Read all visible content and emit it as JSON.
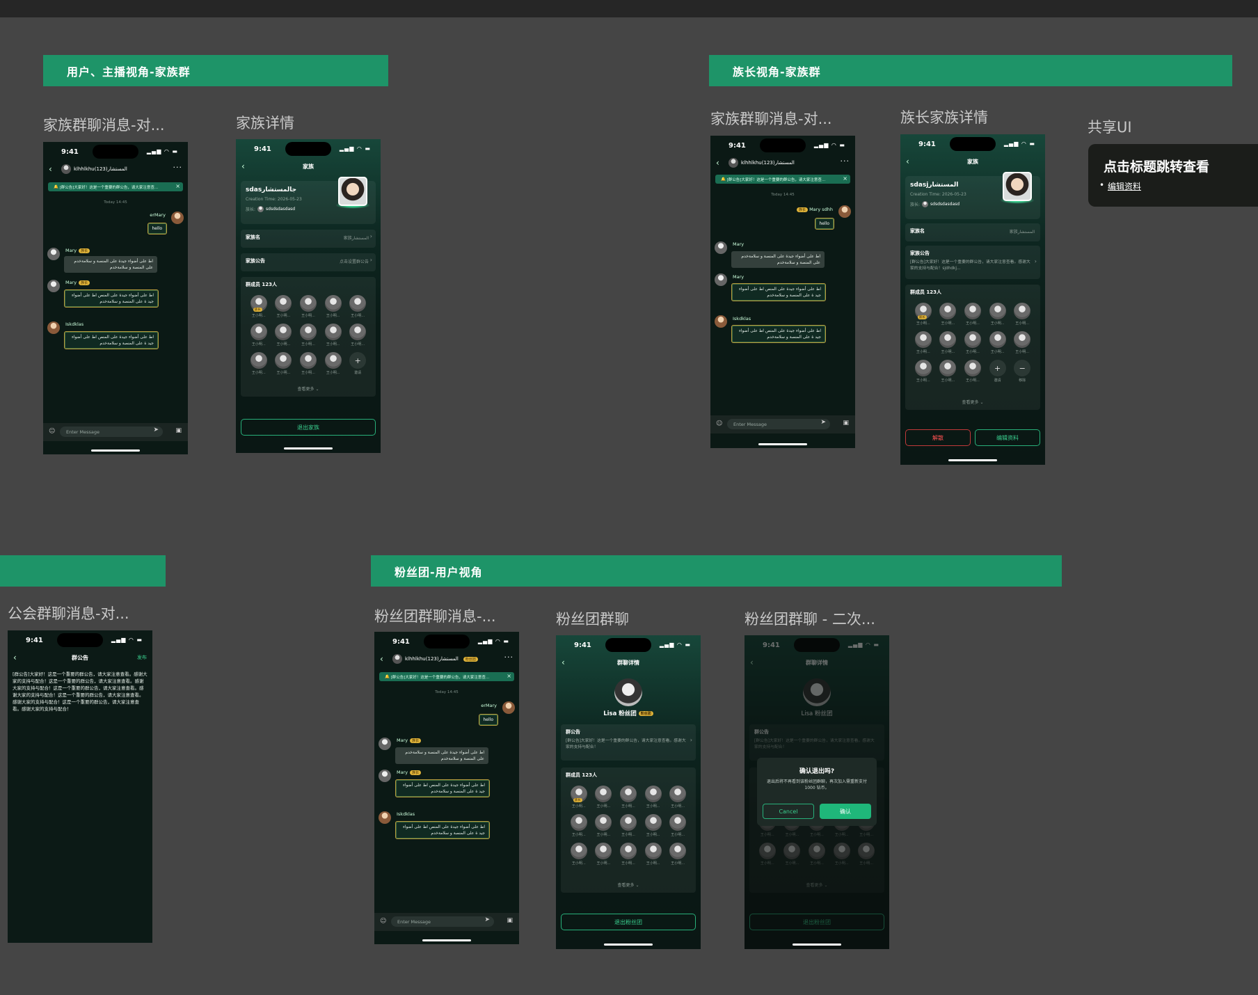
{
  "sections": {
    "user_family": "用户、主播视角-家族群",
    "leader_family": "族长视角-家族群",
    "guild": "",
    "fans": "粉丝团-用户视角"
  },
  "frame_titles": {
    "f1": "家族群聊消息-对...",
    "f2": "家族详情",
    "f3": "家族群聊消息-对...",
    "f4": "族长家族详情",
    "f5": "共享UI",
    "f6": "公会群聊消息-对...",
    "f7": "粉丝团群聊消息-...",
    "f8": "粉丝团群聊",
    "f9": "粉丝团群聊 - 二次..."
  },
  "shared_card": {
    "title": "点击标题跳转查看",
    "link": "编辑资料"
  },
  "status": {
    "time": "9:41",
    "icons": "▂▄▆ ◠ ▬"
  },
  "chat": {
    "group_name": "klhhlkhuالمستشار(123)",
    "fans_badge": "粉丝团",
    "notice": "[群公告]大家好！这是一个重要的群公告，请大家注意查...",
    "timestamp": "Today 14:45",
    "sender_self": "erMary",
    "sender_self_leader": "Mary sdhh",
    "leader_badge": "族长",
    "hello": "hello",
    "mary": "Mary",
    "mary_badge": "族长",
    "iskdklas": "Iskdklas",
    "arabic_gray": "اط على أضواء جيدة على المنصة و سلامةخدم على المنصة و سلامةخدم",
    "arabic_gold": "اط على أضواء جيدة على المنص اط على أضواء جيد ة على المنصة و سلامةخدم",
    "input_placeholder": "Enter Message"
  },
  "family": {
    "nav_title": "家族",
    "name": "sdasجالمستشار",
    "leader_name": "sdasjالمستشار",
    "creation": "Creation Time: 2026-05-23",
    "owner_label": "族长:",
    "owner_name": "sdsdsdasdasd",
    "row_name_label": "家族名",
    "row_name_value": "家族المستشار",
    "row_notice_label": "家族公告",
    "row_notice_value": "点击设置群公告",
    "leader_notice_text": "[群公告]大家好！这是一个重要的群公告，请大家注意查看。感谢大家的支持与配合！sjdhdkj...",
    "members_label": "群成员 123人",
    "member": "王小明...",
    "owner_tag": "族长",
    "invite": "邀请",
    "remove": "移除",
    "see_more": "查看更多 ⌄",
    "quit_btn": "退出家族",
    "disband_btn": "解散",
    "edit_btn": "编辑资料"
  },
  "guild": {
    "nav_title": "群公告",
    "publish": "发布",
    "text": "[群公告]大家好！这是一个重要的群公告，请大家注意查看。感谢大家的支持与配合！这是一个重要的群公告，请大家注意查看。感谢大家的支持与配合！这是一个重要的群公告，请大家注意查看。感谢大家的支持与配合！这是一个重要的群公告，请大家注意查看。感谢大家的支持与配合！这是一个重要的群公告，请大家注意查看。感谢大家的支持与配合！"
  },
  "fans": {
    "nav_title": "群聊详情",
    "name": "Lisa 粉丝团",
    "badge": "粉丝团",
    "notice_label": "群公告",
    "notice_text": "[群公告]大家好！这是一个重要的群公告，请大家注意查看。感谢大家的支持与配合！",
    "members_label": "群成员 123人",
    "quit_btn": "退出粉丝团",
    "dialog_title": "确认退出吗?",
    "dialog_text": "退出后将不再看到该粉丝团群聊，再次加入需重新支付 1000 钻币。",
    "cancel": "Cancel",
    "confirm": "确认"
  },
  "icons": {
    "back": "chevron-left-icon",
    "more": "ellipsis-icon",
    "close": "close-icon",
    "emoji": "emoji-icon",
    "send": "send-icon",
    "image": "image-icon",
    "bell": "bell-icon"
  },
  "colors": {
    "accent": "#1e9468",
    "bg": "#454545",
    "gold": "#e0b43a",
    "danger": "#ff5252"
  }
}
